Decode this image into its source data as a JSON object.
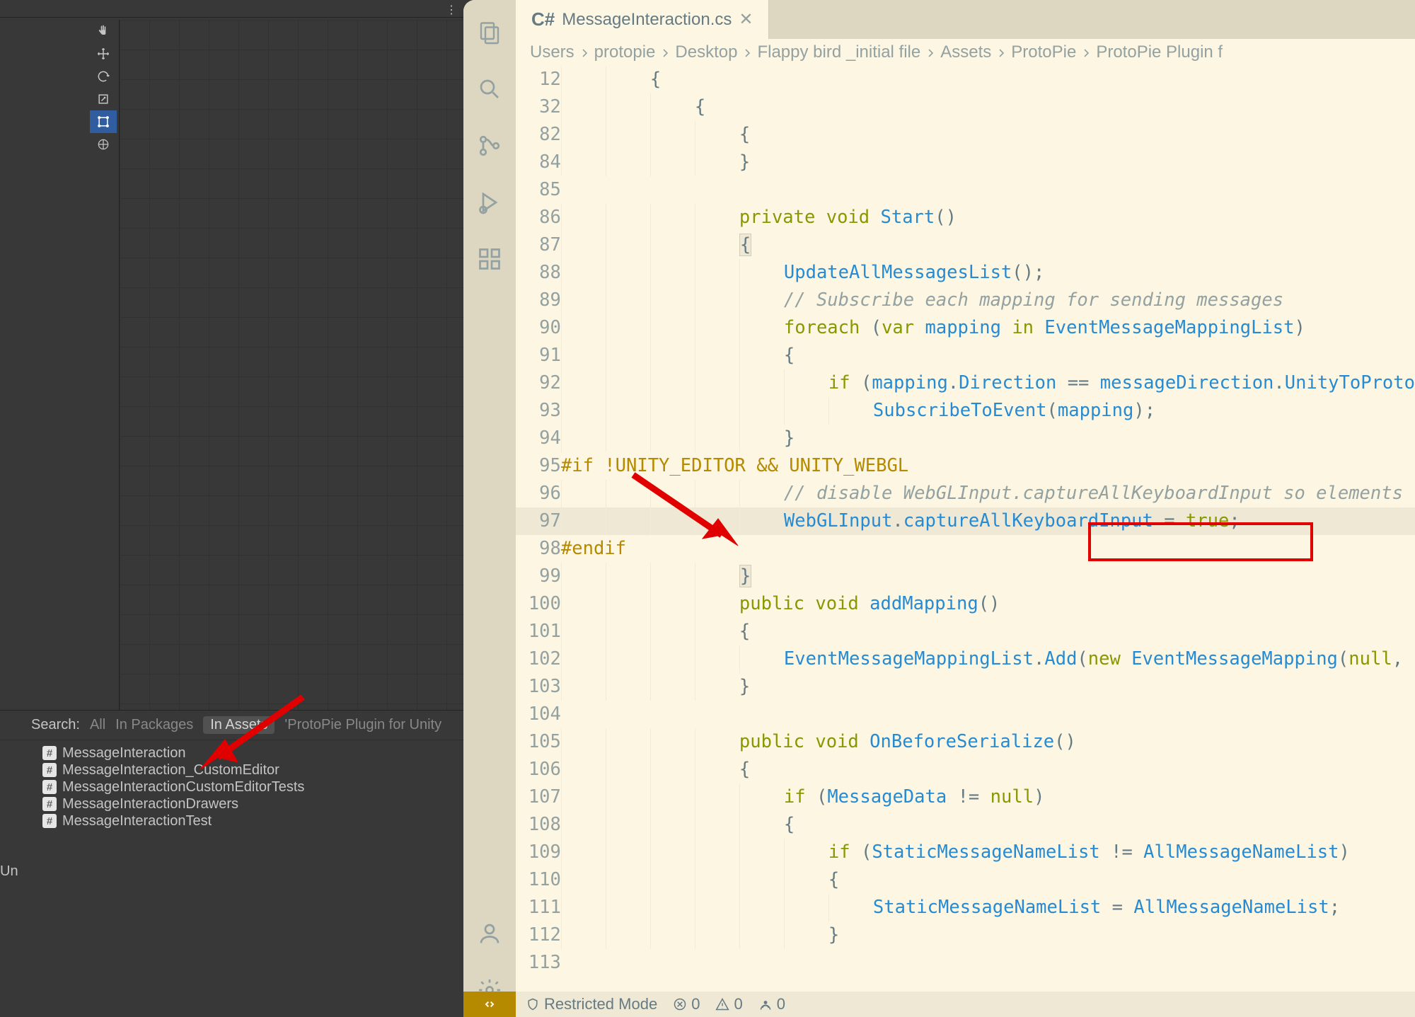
{
  "unity": {
    "search_label": "Search:",
    "filters": [
      "All",
      "In Packages",
      "In Assets"
    ],
    "search_scope": "'ProtoPie Plugin for Unity",
    "files": [
      "MessageInteraction",
      "MessageInteraction_CustomEditor",
      "MessageInteractionCustomEditorTests",
      "MessageInteractionDrawers",
      "MessageInteractionTest"
    ],
    "un_label": "Un"
  },
  "vscode": {
    "tab_filename": "MessageInteraction.cs",
    "breadcrumbs": [
      "Users",
      "protopie",
      "Desktop",
      "Flappy bird _initial file",
      "Assets",
      "ProtoPie",
      "ProtoPie Plugin f"
    ],
    "status": {
      "restricted": "Restricted Mode",
      "errors": "0",
      "warnings": "0",
      "ports": "0"
    },
    "code": {
      "lines": [
        {
          "n": 12,
          "ind": 2,
          "html": "<span class='punc'>{</span>"
        },
        {
          "n": 32,
          "ind": 3,
          "html": "<span class='punc'>{</span>"
        },
        {
          "n": 82,
          "ind": 4,
          "html": "<span class='punc'>{</span>"
        },
        {
          "n": 84,
          "ind": 4,
          "html": "<span class='punc'>}</span>"
        },
        {
          "n": 85,
          "ind": 0,
          "html": ""
        },
        {
          "n": 86,
          "ind": 4,
          "html": "<span class='kw'>private</span> <span class='kw'>void</span> <span class='fn'>Start</span><span class='punc'>()</span>"
        },
        {
          "n": 87,
          "ind": 4,
          "html": "<span class='punc' style='background:#eee8d5;border:1px solid #d3cbb7'>{</span>"
        },
        {
          "n": 88,
          "ind": 5,
          "html": "<span class='fn'>UpdateAllMessagesList</span><span class='punc'>();</span>"
        },
        {
          "n": 89,
          "ind": 5,
          "html": "<span class='cm'>// Subscribe each mapping for sending messages</span>"
        },
        {
          "n": 90,
          "ind": 5,
          "html": "<span class='kw'>foreach</span> <span class='punc'>(</span><span class='kw'>var</span> <span class='var'>mapping</span> <span class='kw'>in</span> <span class='prop'>EventMessageMappingList</span><span class='punc'>)</span>"
        },
        {
          "n": 91,
          "ind": 5,
          "html": "<span class='punc'>{</span>"
        },
        {
          "n": 92,
          "ind": 6,
          "html": "<span class='kw'>if</span> <span class='punc'>(</span><span class='var'>mapping</span><span class='punc'>.</span><span class='prop'>Direction</span> <span class='op'>==</span> <span class='var'>messageDirection</span><span class='punc'>.</span><span class='prop'>UnityToProto</span>"
        },
        {
          "n": 93,
          "ind": 7,
          "html": "<span class='fn'>SubscribeToEvent</span><span class='punc'>(</span><span class='var'>mapping</span><span class='punc'>);</span>"
        },
        {
          "n": 94,
          "ind": 5,
          "html": "<span class='punc'>}</span>"
        },
        {
          "n": 95,
          "ind": 0,
          "html": "<span class='pp'>#if !UNITY_EDITOR && UNITY_WEBGL</span>"
        },
        {
          "n": 96,
          "ind": 5,
          "html": "<span class='cm'>// disable WebGLInput.captureAllKeyboardInput so elements </span>"
        },
        {
          "n": 97,
          "ind": 5,
          "hl": true,
          "html": "<span class='type'>WebGLInput</span><span class='punc'>.</span><span class='prop'>captureAllKeyboardInput</span> <span class='op'>=</span> <span class='kw'>true</span><span class='punc'>;</span>"
        },
        {
          "n": 98,
          "ind": 0,
          "html": "<span class='pp'>#endif</span>"
        },
        {
          "n": 99,
          "ind": 4,
          "html": "<span class='punc' style='background:#eee8d5;border:1px solid #d3cbb7'>}</span>"
        },
        {
          "n": 100,
          "ind": 4,
          "html": "<span class='kw'>public</span> <span class='kw'>void</span> <span class='fn'>addMapping</span><span class='punc'>()</span>"
        },
        {
          "n": 101,
          "ind": 4,
          "html": "<span class='punc'>{</span>"
        },
        {
          "n": 102,
          "ind": 5,
          "html": "<span class='prop'>EventMessageMappingList</span><span class='punc'>.</span><span class='fn'>Add</span><span class='punc'>(</span><span class='kw'>new</span> <span class='type'>EventMessageMapping</span><span class='punc'>(</span><span class='kw'>null</span><span class='punc'>, </span>"
        },
        {
          "n": 103,
          "ind": 4,
          "html": "<span class='punc'>}</span>"
        },
        {
          "n": 104,
          "ind": 0,
          "html": ""
        },
        {
          "n": 105,
          "ind": 4,
          "html": "<span class='kw'>public</span> <span class='kw'>void</span> <span class='fn'>OnBeforeSerialize</span><span class='punc'>()</span>"
        },
        {
          "n": 106,
          "ind": 4,
          "html": "<span class='punc'>{</span>"
        },
        {
          "n": 107,
          "ind": 5,
          "html": "<span class='kw'>if</span> <span class='punc'>(</span><span class='prop'>MessageData</span> <span class='op'>!=</span> <span class='kw'>null</span><span class='punc'>)</span>"
        },
        {
          "n": 108,
          "ind": 5,
          "html": "<span class='punc'>{</span>"
        },
        {
          "n": 109,
          "ind": 6,
          "html": "<span class='kw'>if</span> <span class='punc'>(</span><span class='prop'>StaticMessageNameList</span> <span class='op'>!=</span> <span class='prop'>AllMessageNameList</span><span class='punc'>)</span>"
        },
        {
          "n": 110,
          "ind": 6,
          "html": "<span class='punc'>{</span>"
        },
        {
          "n": 111,
          "ind": 7,
          "html": "<span class='prop'>StaticMessageNameList</span> <span class='op'>=</span> <span class='prop'>AllMessageNameList</span><span class='punc'>;</span>"
        },
        {
          "n": 112,
          "ind": 6,
          "html": "<span class='punc'>}</span>"
        },
        {
          "n": 113,
          "ind": 0,
          "html": ""
        }
      ]
    }
  }
}
